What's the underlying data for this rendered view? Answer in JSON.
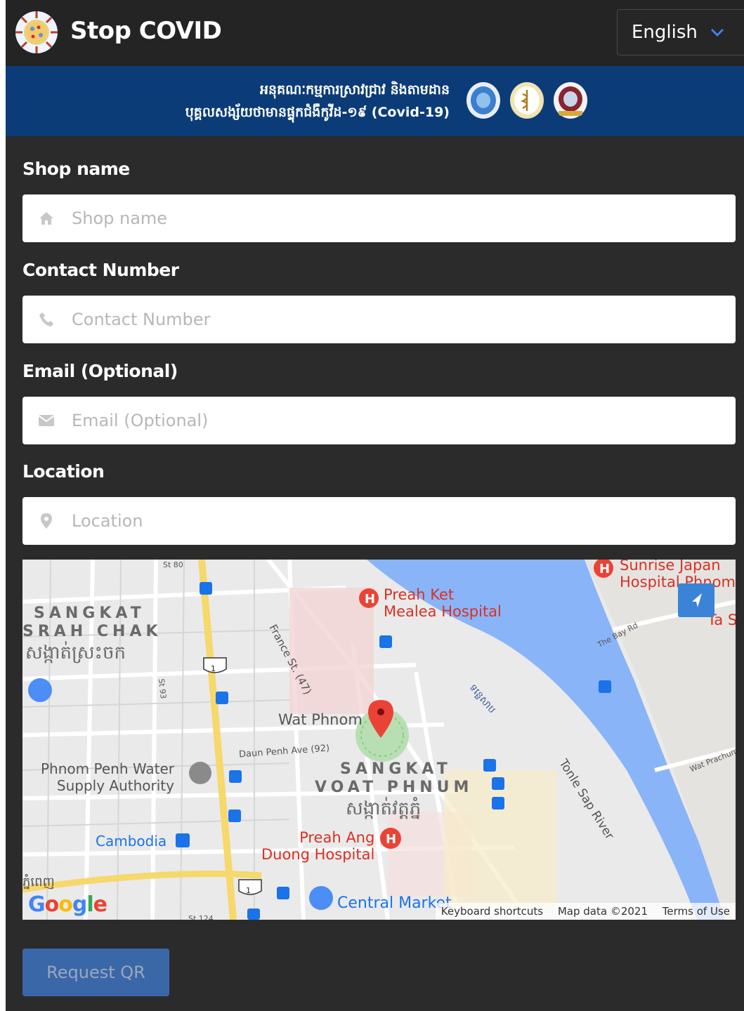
{
  "header": {
    "title": "Stop COVID",
    "language": "English"
  },
  "banner": {
    "line1": "អនុគណៈកម្មការស្រាវជ្រាវ និងតាមដាន",
    "line2": "បុគ្គលសង្ស័យថាមានផ្ទុកជំងឺកូវីដ-១៩ (Covid-19)"
  },
  "form": {
    "shop_name": {
      "label": "Shop name",
      "placeholder": "Shop name",
      "icon": "home-icon"
    },
    "contact": {
      "label": "Contact Number",
      "placeholder": "Contact Number",
      "icon": "phone-icon"
    },
    "email": {
      "label": "Email (Optional)",
      "placeholder": "Email (Optional)",
      "icon": "envelope-icon"
    },
    "location": {
      "label": "Location",
      "placeholder": "Location",
      "icon": "map-marker-icon"
    }
  },
  "map": {
    "labels": {
      "sangkat_srah_chak": "SANGKAT",
      "srah_chak": "SRAH CHAK",
      "srah_chak_km": "សង្កាត់ស្រះចក",
      "sangkat_voat_phnum": "SANGKAT",
      "voat_phnum": "VOAT PHNUM",
      "voat_phnum_km": "សង្កាត់វត្តភ្នំ",
      "preah_ket_1": "Preah Ket",
      "preah_ket_2": "Mealea Hospital",
      "sunrise_1": "Sunrise Japan",
      "sunrise_2": "Hospital Phnom",
      "ta": "Ta S",
      "wat_phnom": "Wat Phnom",
      "daun_penh": "Daun Penh Ave (92)",
      "water_1": "Phnom Penh Water",
      "water_2": "Supply Authority",
      "cambodia": "Cambodia",
      "preah_ang_1": "Preah Ang",
      "preah_ang_2": "Duong Hospital",
      "central_market": "Central Market",
      "france_st": "France St. (47)",
      "tonle_sap": "Tonle Sap River",
      "river_km": "ទន្លេសាប",
      "bay_rd": "The Bay Rd",
      "wat_prachum": "Wat Prachum",
      "st93": "St 93",
      "st80": "St 80",
      "st124": "St 124",
      "km_bottom": "ភ្នំពេញ",
      "route": "1"
    },
    "attribution": {
      "shortcuts": "Keyboard shortcuts",
      "map_data": "Map data ©2021",
      "terms": "Terms of Use"
    },
    "google": "Google"
  },
  "submit_label": "Request QR"
}
